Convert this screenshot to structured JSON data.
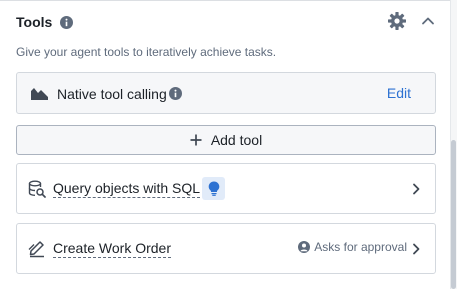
{
  "section": {
    "title": "Tools",
    "subtitle": "Give your agent tools to iteratively achieve tasks."
  },
  "native_tool_calling": {
    "label": "Native tool calling",
    "edit_label": "Edit"
  },
  "add_tool": {
    "label": "Add tool"
  },
  "tools": [
    {
      "name": "Query objects with SQL",
      "icon": "database-search-icon",
      "badge_icon": "lightbulb-icon"
    },
    {
      "name": "Create Work Order",
      "icon": "edit-action-icon",
      "status": "Asks for approval",
      "status_icon": "person-icon"
    }
  ],
  "colors": {
    "accent": "#2d72d2",
    "badge_bg": "#e1ebf9",
    "muted_text": "#5f6b7c"
  }
}
